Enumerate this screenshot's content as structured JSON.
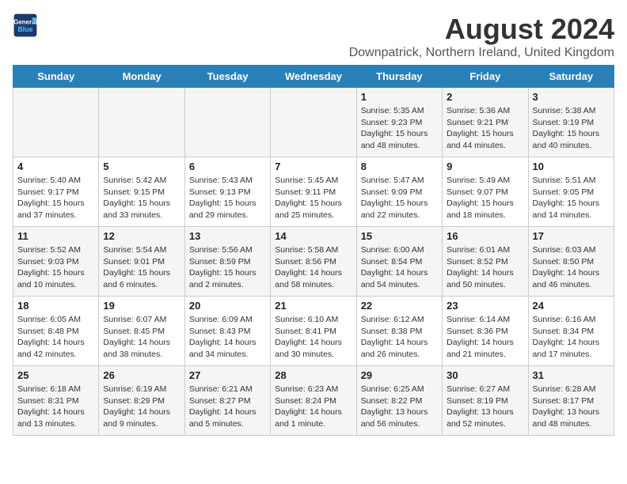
{
  "header": {
    "logo_line1": "General",
    "logo_line2": "Blue",
    "title": "August 2024",
    "subtitle": "Downpatrick, Northern Ireland, United Kingdom"
  },
  "columns": [
    "Sunday",
    "Monday",
    "Tuesday",
    "Wednesday",
    "Thursday",
    "Friday",
    "Saturday"
  ],
  "weeks": [
    [
      {
        "day": "",
        "detail": ""
      },
      {
        "day": "",
        "detail": ""
      },
      {
        "day": "",
        "detail": ""
      },
      {
        "day": "",
        "detail": ""
      },
      {
        "day": "1",
        "detail": "Sunrise: 5:35 AM\nSunset: 9:23 PM\nDaylight: 15 hours\nand 48 minutes."
      },
      {
        "day": "2",
        "detail": "Sunrise: 5:36 AM\nSunset: 9:21 PM\nDaylight: 15 hours\nand 44 minutes."
      },
      {
        "day": "3",
        "detail": "Sunrise: 5:38 AM\nSunset: 9:19 PM\nDaylight: 15 hours\nand 40 minutes."
      }
    ],
    [
      {
        "day": "4",
        "detail": "Sunrise: 5:40 AM\nSunset: 9:17 PM\nDaylight: 15 hours\nand 37 minutes."
      },
      {
        "day": "5",
        "detail": "Sunrise: 5:42 AM\nSunset: 9:15 PM\nDaylight: 15 hours\nand 33 minutes."
      },
      {
        "day": "6",
        "detail": "Sunrise: 5:43 AM\nSunset: 9:13 PM\nDaylight: 15 hours\nand 29 minutes."
      },
      {
        "day": "7",
        "detail": "Sunrise: 5:45 AM\nSunset: 9:11 PM\nDaylight: 15 hours\nand 25 minutes."
      },
      {
        "day": "8",
        "detail": "Sunrise: 5:47 AM\nSunset: 9:09 PM\nDaylight: 15 hours\nand 22 minutes."
      },
      {
        "day": "9",
        "detail": "Sunrise: 5:49 AM\nSunset: 9:07 PM\nDaylight: 15 hours\nand 18 minutes."
      },
      {
        "day": "10",
        "detail": "Sunrise: 5:51 AM\nSunset: 9:05 PM\nDaylight: 15 hours\nand 14 minutes."
      }
    ],
    [
      {
        "day": "11",
        "detail": "Sunrise: 5:52 AM\nSunset: 9:03 PM\nDaylight: 15 hours\nand 10 minutes."
      },
      {
        "day": "12",
        "detail": "Sunrise: 5:54 AM\nSunset: 9:01 PM\nDaylight: 15 hours\nand 6 minutes."
      },
      {
        "day": "13",
        "detail": "Sunrise: 5:56 AM\nSunset: 8:59 PM\nDaylight: 15 hours\nand 2 minutes."
      },
      {
        "day": "14",
        "detail": "Sunrise: 5:58 AM\nSunset: 8:56 PM\nDaylight: 14 hours\nand 58 minutes."
      },
      {
        "day": "15",
        "detail": "Sunrise: 6:00 AM\nSunset: 8:54 PM\nDaylight: 14 hours\nand 54 minutes."
      },
      {
        "day": "16",
        "detail": "Sunrise: 6:01 AM\nSunset: 8:52 PM\nDaylight: 14 hours\nand 50 minutes."
      },
      {
        "day": "17",
        "detail": "Sunrise: 6:03 AM\nSunset: 8:50 PM\nDaylight: 14 hours\nand 46 minutes."
      }
    ],
    [
      {
        "day": "18",
        "detail": "Sunrise: 6:05 AM\nSunset: 8:48 PM\nDaylight: 14 hours\nand 42 minutes."
      },
      {
        "day": "19",
        "detail": "Sunrise: 6:07 AM\nSunset: 8:45 PM\nDaylight: 14 hours\nand 38 minutes."
      },
      {
        "day": "20",
        "detail": "Sunrise: 6:09 AM\nSunset: 8:43 PM\nDaylight: 14 hours\nand 34 minutes."
      },
      {
        "day": "21",
        "detail": "Sunrise: 6:10 AM\nSunset: 8:41 PM\nDaylight: 14 hours\nand 30 minutes."
      },
      {
        "day": "22",
        "detail": "Sunrise: 6:12 AM\nSunset: 8:38 PM\nDaylight: 14 hours\nand 26 minutes."
      },
      {
        "day": "23",
        "detail": "Sunrise: 6:14 AM\nSunset: 8:36 PM\nDaylight: 14 hours\nand 21 minutes."
      },
      {
        "day": "24",
        "detail": "Sunrise: 6:16 AM\nSunset: 8:34 PM\nDaylight: 14 hours\nand 17 minutes."
      }
    ],
    [
      {
        "day": "25",
        "detail": "Sunrise: 6:18 AM\nSunset: 8:31 PM\nDaylight: 14 hours\nand 13 minutes."
      },
      {
        "day": "26",
        "detail": "Sunrise: 6:19 AM\nSunset: 8:29 PM\nDaylight: 14 hours\nand 9 minutes."
      },
      {
        "day": "27",
        "detail": "Sunrise: 6:21 AM\nSunset: 8:27 PM\nDaylight: 14 hours\nand 5 minutes."
      },
      {
        "day": "28",
        "detail": "Sunrise: 6:23 AM\nSunset: 8:24 PM\nDaylight: 14 hours\nand 1 minute."
      },
      {
        "day": "29",
        "detail": "Sunrise: 6:25 AM\nSunset: 8:22 PM\nDaylight: 13 hours\nand 56 minutes."
      },
      {
        "day": "30",
        "detail": "Sunrise: 6:27 AM\nSunset: 8:19 PM\nDaylight: 13 hours\nand 52 minutes."
      },
      {
        "day": "31",
        "detail": "Sunrise: 6:28 AM\nSunset: 8:17 PM\nDaylight: 13 hours\nand 48 minutes."
      }
    ]
  ]
}
